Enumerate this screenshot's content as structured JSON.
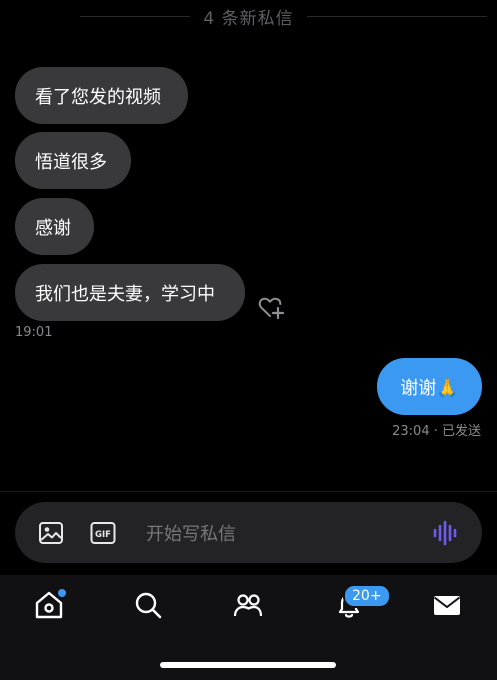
{
  "header": {
    "new_messages": "4 条新私信"
  },
  "messages_in": [
    {
      "text": "看了您发的视频"
    },
    {
      "text": "悟道很多"
    },
    {
      "text": "感谢"
    },
    {
      "text": "我们也是夫妻，学习中"
    }
  ],
  "incoming_time": "19:01",
  "message_out": {
    "text": "谢谢🙏",
    "time_status": "23:04 · 已发送"
  },
  "composer": {
    "placeholder": "开始写私信",
    "gif_label": "GIF"
  },
  "tabbar": {
    "notifications_badge": "20+"
  },
  "colors": {
    "accent": "#3b99f1",
    "bubble_in": "#39393c",
    "background": "#000000"
  },
  "icons": [
    "heart-plus-icon",
    "image-icon",
    "gif-icon",
    "voice-wave-icon",
    "home-icon",
    "search-icon",
    "people-icon",
    "bell-icon",
    "mail-icon"
  ]
}
